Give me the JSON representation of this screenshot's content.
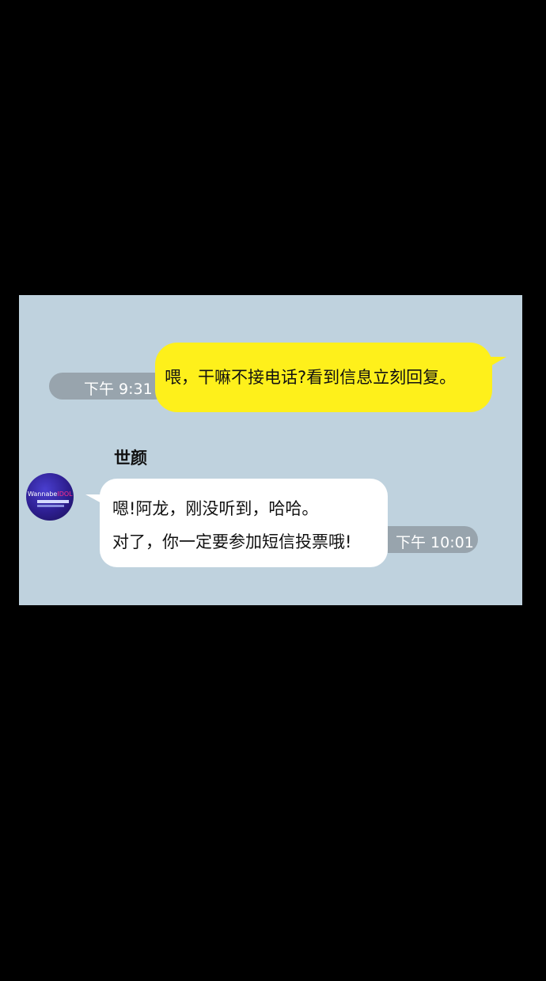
{
  "colors": {
    "background": "#000000",
    "chat_background": "#bfd2de",
    "outgoing_bubble": "#fef01b",
    "incoming_bubble": "#ffffff",
    "time_pill": "#98a4ad"
  },
  "messages": {
    "outgoing": {
      "text": "喂，干嘛不接电话?看到信息立刻回复。",
      "time": "下午 9:31"
    },
    "incoming": {
      "sender": "世颜",
      "avatar": {
        "icon": "wannabe-idol-logo",
        "brand_text": "Wannabe",
        "brand_accent": "IDOL"
      },
      "lines": [
        "嗯!阿龙，刚没听到，哈哈。",
        "对了，你一定要参加短信投票哦!"
      ],
      "time": "下午 10:01"
    }
  }
}
